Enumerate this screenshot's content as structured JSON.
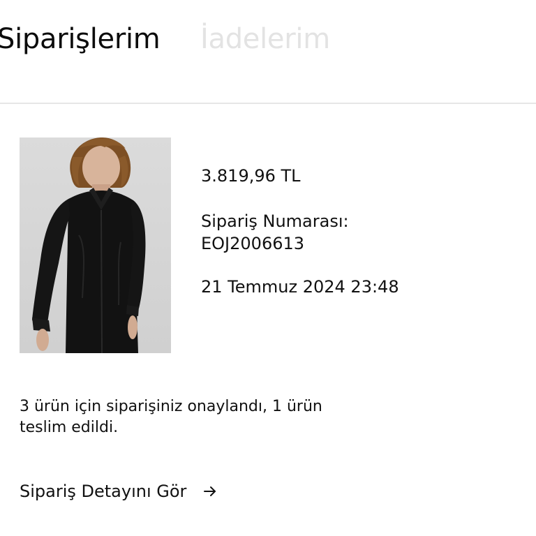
{
  "tabs": {
    "active": "Siparişlerim",
    "inactive": "İadelerim"
  },
  "order": {
    "product_image": {
      "alt": "Siyah gömlek giyen model",
      "colors": {
        "background": "#d6d6d6",
        "shirt": "#111111",
        "hair": "#8a5a2b",
        "skin": "#d8b49b"
      }
    },
    "price": "3.819,96 TL",
    "order_number_label": "Sipariş Numarası:",
    "order_number": "EOJ2006613",
    "date": "21 Temmuz 2024 23:48",
    "status": "3 ürün için siparişiniz onaylandı, 1 ürün teslim edildi.",
    "detail_link": {
      "label": "Sipariş Detayını Gör",
      "icon": "arrow-right-icon"
    }
  }
}
